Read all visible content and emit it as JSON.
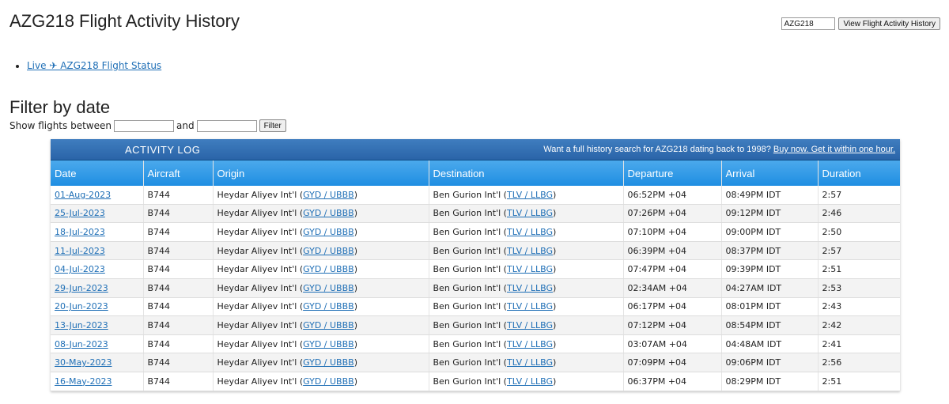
{
  "page": {
    "title": "AZG218 Flight Activity History"
  },
  "search": {
    "value": "AZG218",
    "button_label": "View Flight Activity History"
  },
  "live_link": {
    "label": "Live ✈ AZG218 Flight Status"
  },
  "filter": {
    "heading": "Filter by date",
    "show_label": "Show flights between",
    "and_label": "and",
    "from_value": "",
    "to_value": "",
    "button_label": "Filter"
  },
  "activity_log": {
    "title": "ACTIVITY LOG",
    "promo_text": "Want a full history search for AZG218 dating back to 1998?",
    "promo_link": "Buy now. Get it within one hour.",
    "columns": [
      "Date",
      "Aircraft",
      "Origin",
      "Destination",
      "Departure",
      "Arrival",
      "Duration"
    ],
    "rows": [
      {
        "date": "01-Aug-2023",
        "aircraft": "B744",
        "origin": "Heydar Aliyev Int'l",
        "origin_code": "GYD / UBBB",
        "destination": "Ben Gurion Int'l",
        "destination_code": "TLV / LLBG",
        "departure": "06:52PM +04",
        "arrival": "08:49PM IDT",
        "duration": "2:57"
      },
      {
        "date": "25-Jul-2023",
        "aircraft": "B744",
        "origin": "Heydar Aliyev Int'l",
        "origin_code": "GYD / UBBB",
        "destination": "Ben Gurion Int'l",
        "destination_code": "TLV / LLBG",
        "departure": "07:26PM +04",
        "arrival": "09:12PM IDT",
        "duration": "2:46"
      },
      {
        "date": "18-Jul-2023",
        "aircraft": "B744",
        "origin": "Heydar Aliyev Int'l",
        "origin_code": "GYD / UBBB",
        "destination": "Ben Gurion Int'l",
        "destination_code": "TLV / LLBG",
        "departure": "07:10PM +04",
        "arrival": "09:00PM IDT",
        "duration": "2:50"
      },
      {
        "date": "11-Jul-2023",
        "aircraft": "B744",
        "origin": "Heydar Aliyev Int'l",
        "origin_code": "GYD / UBBB",
        "destination": "Ben Gurion Int'l",
        "destination_code": "TLV / LLBG",
        "departure": "06:39PM +04",
        "arrival": "08:37PM IDT",
        "duration": "2:57"
      },
      {
        "date": "04-Jul-2023",
        "aircraft": "B744",
        "origin": "Heydar Aliyev Int'l",
        "origin_code": "GYD / UBBB",
        "destination": "Ben Gurion Int'l",
        "destination_code": "TLV / LLBG",
        "departure": "07:47PM +04",
        "arrival": "09:39PM IDT",
        "duration": "2:51"
      },
      {
        "date": "29-Jun-2023",
        "aircraft": "B744",
        "origin": "Heydar Aliyev Int'l",
        "origin_code": "GYD / UBBB",
        "destination": "Ben Gurion Int'l",
        "destination_code": "TLV / LLBG",
        "departure": "02:34AM +04",
        "arrival": "04:27AM IDT",
        "duration": "2:53"
      },
      {
        "date": "20-Jun-2023",
        "aircraft": "B744",
        "origin": "Heydar Aliyev Int'l",
        "origin_code": "GYD / UBBB",
        "destination": "Ben Gurion Int'l",
        "destination_code": "TLV / LLBG",
        "departure": "06:17PM +04",
        "arrival": "08:01PM IDT",
        "duration": "2:43"
      },
      {
        "date": "13-Jun-2023",
        "aircraft": "B744",
        "origin": "Heydar Aliyev Int'l",
        "origin_code": "GYD / UBBB",
        "destination": "Ben Gurion Int'l",
        "destination_code": "TLV / LLBG",
        "departure": "07:12PM +04",
        "arrival": "08:54PM IDT",
        "duration": "2:42"
      },
      {
        "date": "08-Jun-2023",
        "aircraft": "B744",
        "origin": "Heydar Aliyev Int'l",
        "origin_code": "GYD / UBBB",
        "destination": "Ben Gurion Int'l",
        "destination_code": "TLV / LLBG",
        "departure": "03:07AM +04",
        "arrival": "04:48AM IDT",
        "duration": "2:41"
      },
      {
        "date": "30-May-2023",
        "aircraft": "B744",
        "origin": "Heydar Aliyev Int'l",
        "origin_code": "GYD / UBBB",
        "destination": "Ben Gurion Int'l",
        "destination_code": "TLV / LLBG",
        "departure": "07:09PM +04",
        "arrival": "09:06PM IDT",
        "duration": "2:56"
      },
      {
        "date": "16-May-2023",
        "aircraft": "B744",
        "origin": "Heydar Aliyev Int'l",
        "origin_code": "GYD / UBBB",
        "destination": "Ben Gurion Int'l",
        "destination_code": "TLV / LLBG",
        "departure": "06:37PM +04",
        "arrival": "08:29PM IDT",
        "duration": "2:51"
      }
    ]
  }
}
